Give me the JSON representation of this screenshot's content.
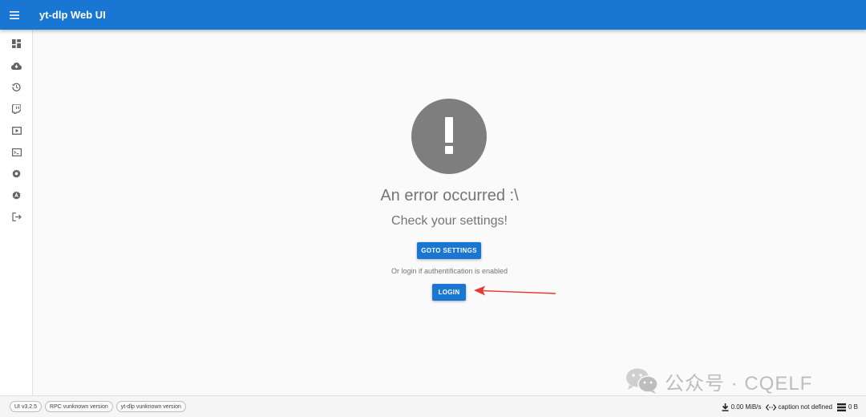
{
  "appbar": {
    "title": "yt-dlp Web UI"
  },
  "sidebar": {
    "items": [
      {
        "name": "dashboard-icon"
      },
      {
        "name": "cloud-download-icon"
      },
      {
        "name": "history-icon"
      },
      {
        "name": "twitch-icon"
      },
      {
        "name": "video-library-icon"
      },
      {
        "name": "terminal-icon"
      },
      {
        "name": "settings-icon"
      },
      {
        "name": "auto-settings-icon"
      },
      {
        "name": "logout-icon"
      }
    ]
  },
  "error": {
    "title": "An error occurred :\\",
    "subtitle": "Check your settings!",
    "goto_label": "GOTO SETTINGS",
    "note": "Or login if authentification is enabled",
    "login_label": "LOGIN"
  },
  "watermark": {
    "text": "公众号 · CQELF"
  },
  "footer": {
    "chips": [
      "UI v3.2.5",
      "RPC vunknown version",
      "yt-dlp vunknown version"
    ],
    "speed": "0.00 MiB/s",
    "caption": "caption not defined",
    "size": "0 B"
  },
  "colors": {
    "primary": "#1976d2",
    "error_circle": "#7e7e7e",
    "arrow": "#e53935"
  }
}
